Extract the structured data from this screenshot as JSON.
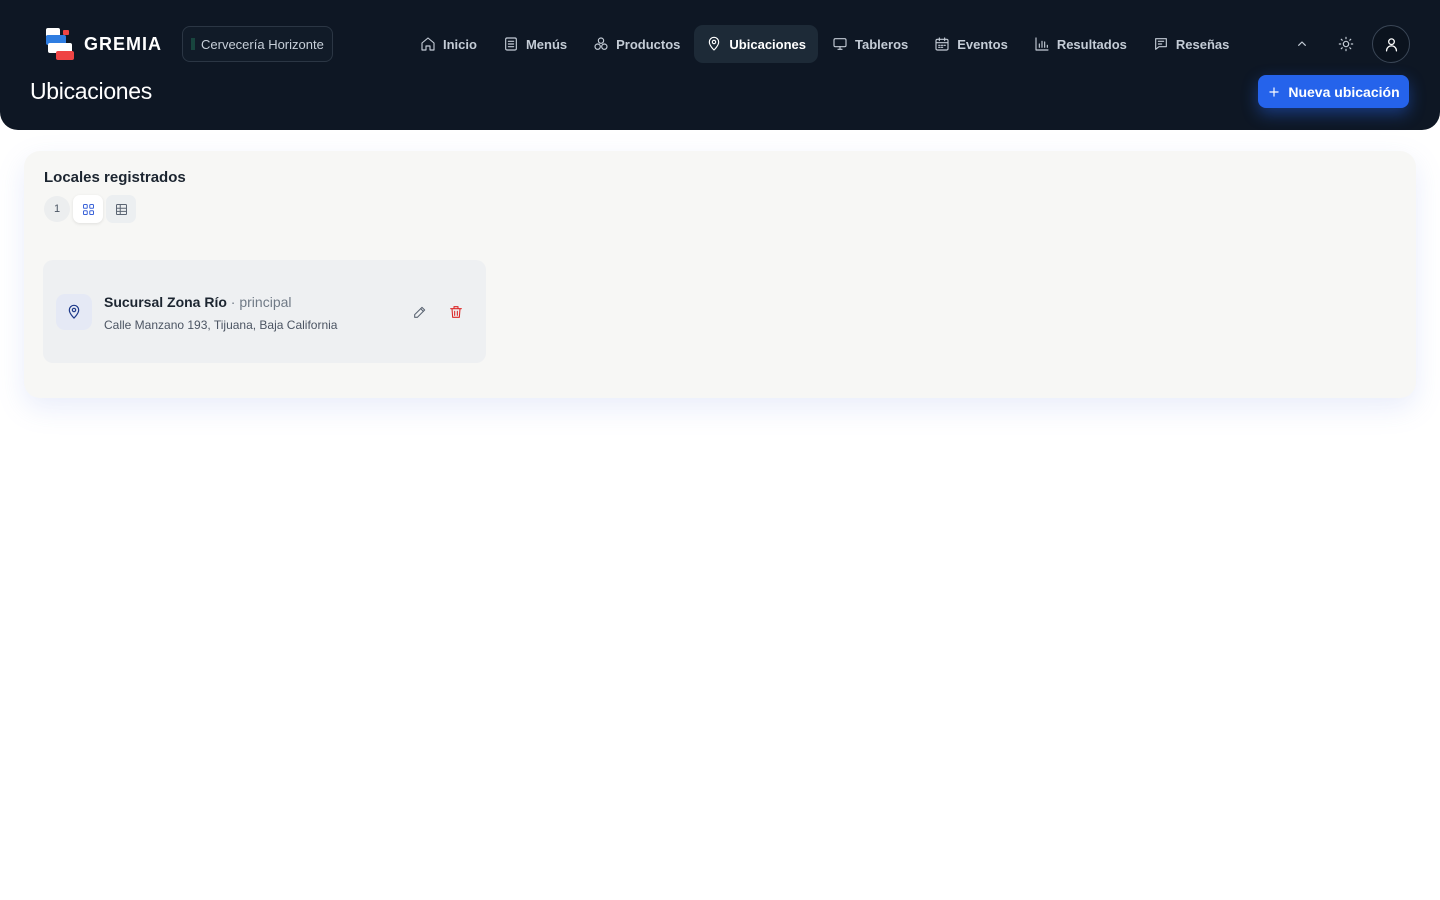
{
  "brand": {
    "name": "GREMIA"
  },
  "tenant": {
    "label": "Cervecería Horizonte",
    "status_color": "#2ec27e"
  },
  "nav": {
    "items": [
      {
        "label": "Inicio",
        "icon": "home-icon",
        "active": false
      },
      {
        "label": "Menús",
        "icon": "menu-doc-icon",
        "active": false
      },
      {
        "label": "Productos",
        "icon": "products-icon",
        "active": false
      },
      {
        "label": "Ubicaciones",
        "icon": "map-pin-icon",
        "active": true
      },
      {
        "label": "Tableros",
        "icon": "monitor-icon",
        "active": false
      },
      {
        "label": "Eventos",
        "icon": "calendar-icon",
        "active": false
      },
      {
        "label": "Resultados",
        "icon": "bar-chart-icon",
        "active": false
      },
      {
        "label": "Reseñas",
        "icon": "reviews-icon",
        "active": false
      }
    ]
  },
  "header": {
    "page_title": "Ubicaciones",
    "primary_action": "Nueva ubicación",
    "accent_color": "#2563eb"
  },
  "panel": {
    "title": "Locales registrados",
    "count": "1",
    "view_modes": [
      "grid",
      "table"
    ],
    "active_view": "grid"
  },
  "locations": [
    {
      "name": "Sucursal Zona Río",
      "tag": " · principal",
      "address": "Calle Manzano 193, Tijuana, Baja California"
    }
  ]
}
